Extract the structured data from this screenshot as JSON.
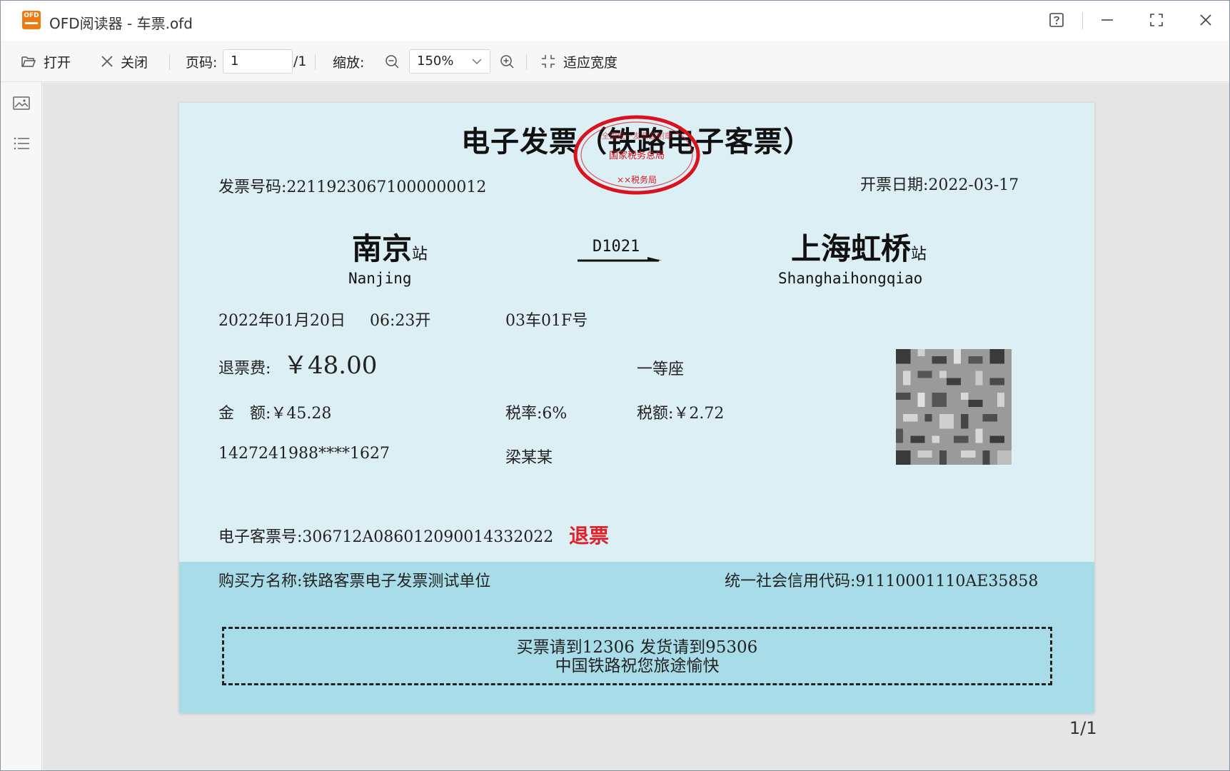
{
  "window": {
    "app_name": "OFD阅读器",
    "title_suffix": "- 车票.ofd",
    "logo_text": "OFD"
  },
  "toolbar": {
    "open_label": "打开",
    "close_label": "关闭",
    "page_label": "页码:",
    "page_value": "1",
    "page_total": "/1",
    "zoom_label": "缩放:",
    "zoom_value": "150%",
    "fit_width_label": "适应宽度"
  },
  "viewer": {
    "page_counter": "1/1"
  },
  "ticket": {
    "title": "电子发票（铁路电子客票）",
    "invoice_no": "发票号码:22119230671000000012",
    "issue_date": "开票日期:2022-03-17",
    "from_station": "南京",
    "from_station_suffix": "站",
    "from_pinyin": "Nanjing",
    "train_no": "D1021",
    "to_station": "上海虹桥",
    "to_station_suffix": "站",
    "to_pinyin": "Shanghaihongqiao",
    "date": "2022年01月20日",
    "time": "06:23开",
    "seat": "03车01F号",
    "refund_fee_label": "退票费:",
    "refund_fee_value": "￥48.00",
    "seat_class": "一等座",
    "amount": "金　额:￥45.28",
    "tax_rate": "税率:6%",
    "tax_amount": "税额:￥2.72",
    "id_no": "1427241988****1627",
    "passenger": "梁某某",
    "e_ticket_no": "电子客票号:306712A0860120900143320​22",
    "refund_mark": "退票",
    "buyer": "购买方名称:铁路客票电子发票测试单位",
    "credit_code": "统一社会信用代码:91110001110AE35858",
    "notice_line1": "买票请到12306 发货请到95306",
    "notice_line2": "中国铁路祝您旅途愉快",
    "stamp_top": "全国统一发票监制章",
    "stamp_middle": "国家税务总局",
    "stamp_bottom": "××税务局"
  },
  "colors": {
    "ticket_bg": "#dceff5",
    "ticket_bottom_bg": "#a8dce8",
    "refund_red": "#e2202a",
    "stamp_red": "#d8121e",
    "app_orange": "#f07a12"
  }
}
